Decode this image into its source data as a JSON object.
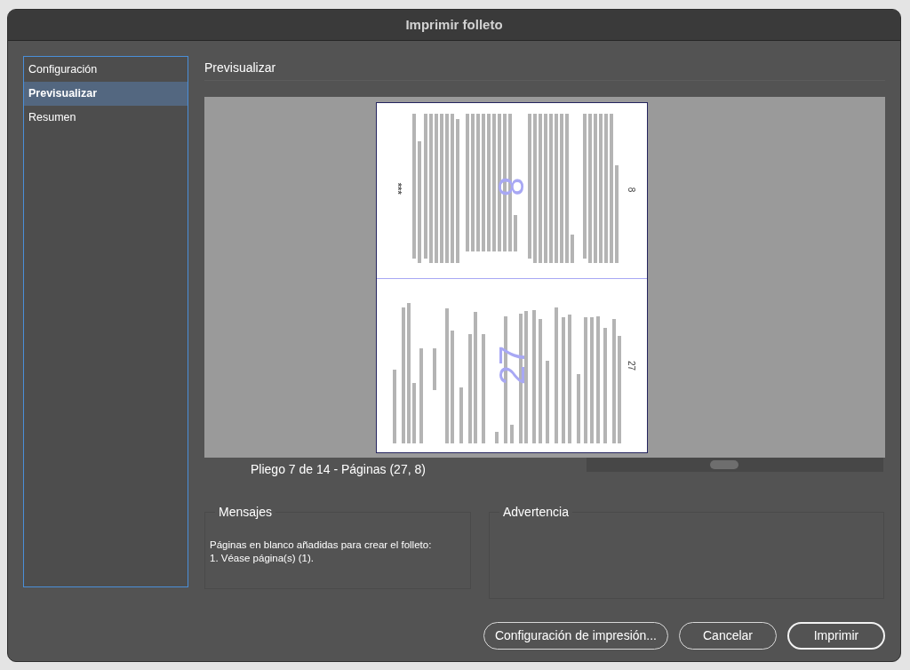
{
  "window": {
    "title": "Imprimir folleto"
  },
  "sidebar": {
    "items": [
      {
        "label": "Configuración",
        "selected": false
      },
      {
        "label": "Previsualizar",
        "selected": true
      },
      {
        "label": "Resumen",
        "selected": false
      }
    ]
  },
  "preview": {
    "heading": "Previsualizar",
    "top_page": {
      "marker": "***",
      "number_large": "8",
      "number_footer": "8"
    },
    "bottom_page": {
      "number_large": "27",
      "number_footer": "27"
    },
    "caption": "Pliego 7 de 14 - Páginas (27, 8)"
  },
  "messages": {
    "title": "Mensajes",
    "text": "Páginas en blanco añadidas para crear el folleto: 1. Véase página(s) (1)."
  },
  "warning": {
    "title": "Advertencia"
  },
  "buttons": [
    {
      "label": "Configuración de impresión...",
      "primary": false
    },
    {
      "label": "Cancelar",
      "primary": false
    },
    {
      "label": "Imprimir",
      "primary": true
    }
  ]
}
